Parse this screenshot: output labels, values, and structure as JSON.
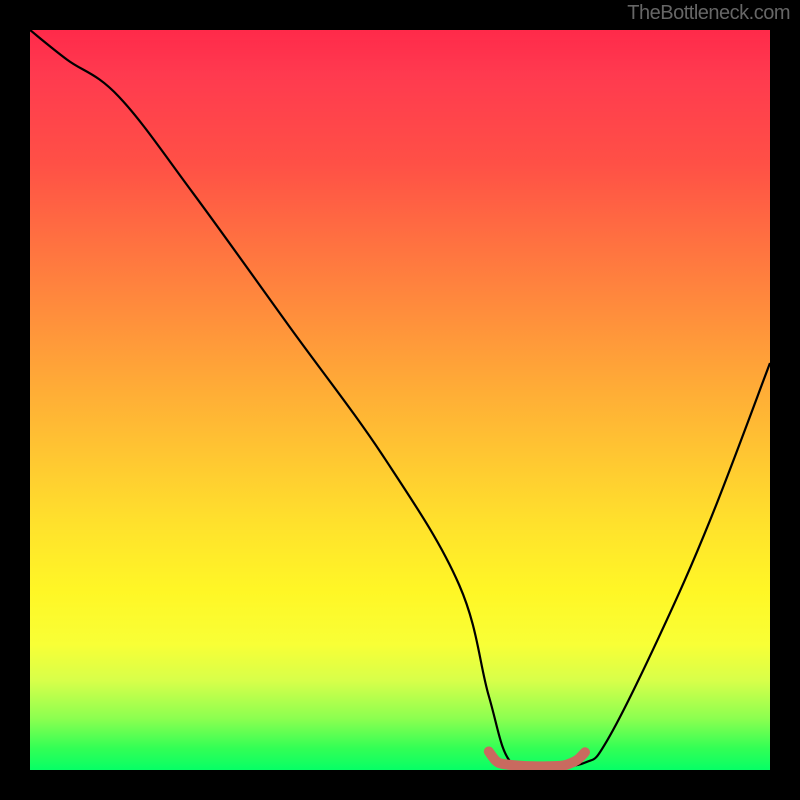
{
  "watermark": "TheBottleneck.com",
  "colors": {
    "background": "#000000",
    "curve": "#000000",
    "marker": "#c96a5f",
    "gradient_top": "#ff2a4a",
    "gradient_bottom": "#06ff66"
  },
  "chart_data": {
    "type": "line",
    "title": "",
    "xlabel": "",
    "ylabel": "",
    "xlim": [
      0,
      100
    ],
    "ylim": [
      0,
      100
    ],
    "grid": false,
    "legend": "none",
    "notes": "Bottleneck curve over red-to-green gradient. X axis implied parameter 0-100, Y axis implied bottleneck percentage 0-100. Minimum plateau around x 63-75 at y≈0.5.",
    "series": [
      {
        "name": "bottleneck-curve",
        "x": [
          0,
          5,
          12,
          22,
          35,
          48,
          58,
          62,
          65,
          70,
          75,
          78,
          85,
          92,
          100
        ],
        "y": [
          100,
          96,
          91,
          78,
          60,
          42,
          25,
          10,
          1,
          0.5,
          1,
          4,
          18,
          34,
          55
        ]
      },
      {
        "name": "minimum-marker",
        "x": [
          62,
          63,
          64,
          66,
          68,
          70,
          72,
          73,
          74,
          75
        ],
        "y": [
          2.5,
          1.2,
          0.8,
          0.6,
          0.5,
          0.5,
          0.6,
          0.9,
          1.4,
          2.4
        ]
      }
    ]
  }
}
